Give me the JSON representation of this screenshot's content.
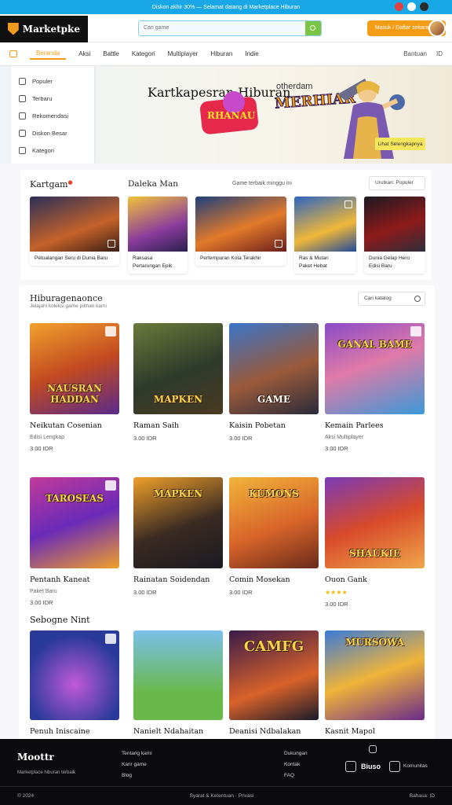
{
  "topbar": {
    "message": "Diskon akhir 30% — Selamat datang di Marketplace Hiburan"
  },
  "header": {
    "logo": "Marketpke",
    "search_placeholder": "Cari game",
    "cta_label": "Masuk / Daftar sekarang"
  },
  "nav": {
    "items": [
      "Beranda",
      "Aksi",
      "Battle",
      "Kategori",
      "Multiplayer",
      "Hiburan",
      "Indie"
    ],
    "active_index": 0,
    "right": [
      "Bantuan",
      "ID"
    ]
  },
  "sidemenu": {
    "items": [
      "Populer",
      "Terbaru",
      "Rekomendasi",
      "Diskon Besar",
      "Kategori"
    ]
  },
  "hero": {
    "title": "Kartkapesran Hiburan",
    "sub": "otherdam",
    "logo": "MERHIAR",
    "badge": "RHANAU",
    "button": "Lihat Selengkapnya"
  },
  "featured": {
    "title": "Kartgam",
    "title2": "Daleka Man",
    "label": "Game terbaik minggu ini",
    "select": "Urutkan: Populer",
    "items": [
      {
        "line1": "Petualangan Seru di Dunia Baru",
        "line2": ""
      },
      {
        "line1": "Raksasa",
        "line2": "Pertarungan Epik"
      },
      {
        "line1": "Pertempuran Kota Terakhir",
        "line2": ""
      },
      {
        "line1": "Ras & Mutan",
        "line2": "Paket Hebat"
      },
      {
        "line1": "Dunia Gelap Hero",
        "line2": "Edisi Baru"
      }
    ]
  },
  "catalog": {
    "title": "Hiburagenaonce",
    "subtitle": "Jelajahi koleksi game pilihan kami",
    "search_placeholder": "Cari katalog",
    "section3_title": "Sebogne Nint",
    "games": [
      {
        "name": "Neikutan Cosenian",
        "sub": "Edisi Lengkap",
        "price": "3.00 IDR",
        "art": "NAUSRAN HADDAN"
      },
      {
        "name": "Raman Saih",
        "sub": "",
        "price": "3.00 IDR",
        "art": "MAPKEN"
      },
      {
        "name": "Kaisin Pobetan",
        "sub": "",
        "price": "3.00 IDR",
        "art": "GAME"
      },
      {
        "name": "Kemain Parlees",
        "sub": "Aksi Multiplayer",
        "price": "3.00 IDR",
        "art": "GANAL BAME"
      },
      {
        "name": "Pentanh Kaneat",
        "sub": "Paket Baru",
        "price": "3.00 IDR",
        "art": "TAROSEAS"
      },
      {
        "name": "Rainatan Soidendan",
        "sub": "",
        "price": "3.00 IDR",
        "art": "MAPKEN"
      },
      {
        "name": "Comin Mosekan",
        "sub": "",
        "price": "3.00 IDR",
        "art": "KUMONS"
      },
      {
        "name": "Ouon Gank",
        "sub": "",
        "price": "3.00 IDR",
        "art": "SHAUKIE",
        "stars": "★★★★"
      },
      {
        "name": "Penuh Iniscaine",
        "sub": "",
        "price": "",
        "art": ""
      },
      {
        "name": "Nanielt Ndahaitan",
        "sub": "",
        "price": "",
        "art": ""
      },
      {
        "name": "Deanisi Ndbalakan",
        "sub": "",
        "price": "",
        "art": "CAMFG"
      },
      {
        "name": "Kasnit Mapol",
        "sub": "",
        "price": "",
        "art": "MURSOWA"
      }
    ]
  },
  "footer": {
    "logo": "Moottr",
    "tagline": "Marketplace hiburan terbaik",
    "copyright": "© 2024",
    "col1": [
      "Tentang kami",
      "Karir game",
      "Blog"
    ],
    "col2": [
      "Dukungan",
      "Kontak",
      "FAQ"
    ],
    "brand1": "Biuso",
    "brand2": "Komunitas",
    "bottom_center": "Syarat & Ketentuan · Privasi",
    "bottom_right": "Bahasa: ID"
  }
}
